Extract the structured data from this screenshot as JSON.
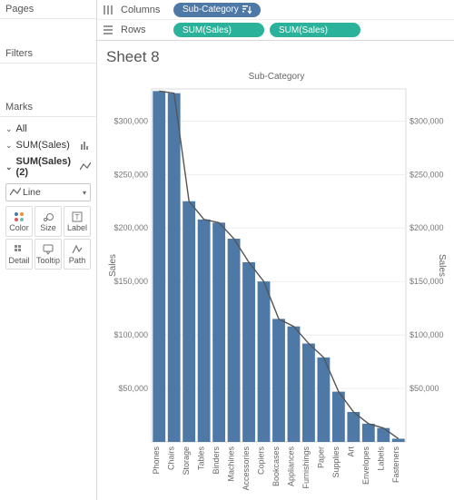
{
  "panels": {
    "pages": "Pages",
    "filters": "Filters",
    "marks": "Marks"
  },
  "marks": {
    "rows": [
      {
        "label": "All",
        "type": ""
      },
      {
        "label": "SUM(Sales)",
        "type": "bar"
      },
      {
        "label": "SUM(Sales) (2)",
        "type": "line"
      }
    ],
    "selected_mark_type": "Line",
    "cards": [
      "Color",
      "Size",
      "Label",
      "Detail",
      "Tooltip",
      "Path"
    ]
  },
  "shelves": {
    "columns_label": "Columns",
    "rows_label": "Rows",
    "columns_pill": "Sub-Category",
    "rows_pill_1": "SUM(Sales)",
    "rows_pill_2": "SUM(Sales)"
  },
  "viz": {
    "sheet_title": "Sheet 8",
    "chart_title": "Sub-Category",
    "y_axis_label": "Sales",
    "y_axis_label_right": "Sales"
  },
  "chart_data": {
    "type": "bar+line",
    "ylim": [
      0,
      330000
    ],
    "ticks": [
      50000,
      100000,
      150000,
      200000,
      250000,
      300000
    ],
    "tick_labels": [
      "$50,000",
      "$100,000",
      "$150,000",
      "$200,000",
      "$250,000",
      "$300,000"
    ],
    "title": "Sub-Category",
    "ylabel": "Sales",
    "categories": [
      "Phones",
      "Chairs",
      "Storage",
      "Tables",
      "Binders",
      "Machines",
      "Accessories",
      "Copiers",
      "Bookcases",
      "Appliances",
      "Furnishings",
      "Paper",
      "Supplies",
      "Art",
      "Envelopes",
      "Labels",
      "Fasteners"
    ],
    "values": [
      328000,
      326000,
      225000,
      208000,
      205000,
      190000,
      168000,
      150000,
      115000,
      108000,
      92000,
      79000,
      47000,
      28000,
      17000,
      13000,
      3000
    ]
  },
  "colors": {
    "bar": "#4e79a7",
    "line": "#555555"
  }
}
